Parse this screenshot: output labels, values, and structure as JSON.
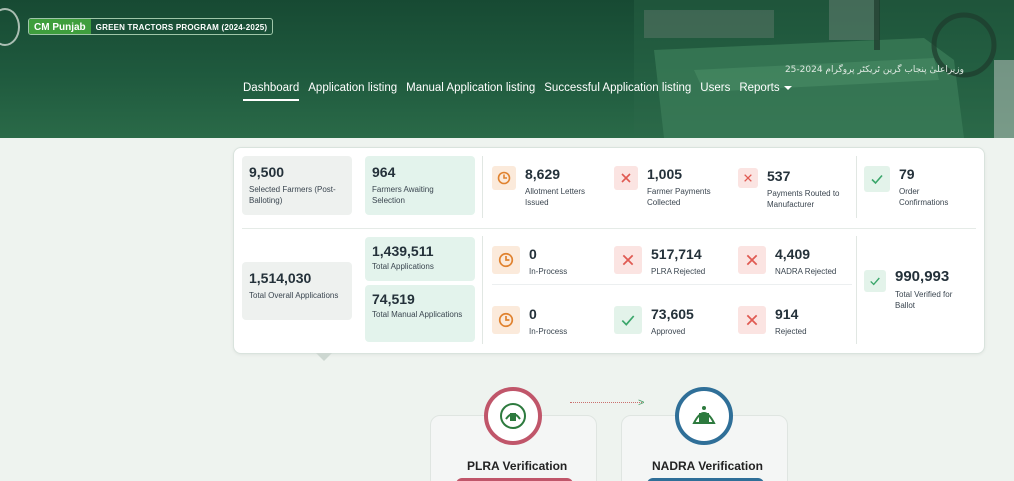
{
  "header": {
    "brand_cm": "CM Punjab",
    "brand_program": "GREEN TRACTORS PROGRAM (2024-2025)",
    "banner_text": "وزیراعلیٰ پنجاب گرین ٹریکٹر پروگرام 2024-25"
  },
  "nav": {
    "dashboard": "Dashboard",
    "application_listing": "Application listing",
    "manual_application_listing": "Manual Application listing",
    "successful_application_listing": "Successful Application listing",
    "users": "Users",
    "reports": "Reports"
  },
  "stats": {
    "selected_farmers": {
      "value": "9,500",
      "label": "Selected Farmers (Post-Balloting)"
    },
    "farmers_awaiting": {
      "value": "964",
      "label": "Farmers Awaiting Selection"
    },
    "allotment_letters": {
      "value": "8,629",
      "label": "Allotment Letters Issued"
    },
    "farmer_payments": {
      "value": "1,005",
      "label": "Farmer Payments Collected"
    },
    "payments_routed": {
      "value": "537",
      "label": "Payments Routed to Manufacturer"
    },
    "order_confirmations": {
      "value": "79",
      "label": "Order Confirmations"
    },
    "total_overall": {
      "value": "1,514,030",
      "label": "Total Overall Applications"
    },
    "total_applications": {
      "value": "1,439,511",
      "label": "Total Applications"
    },
    "total_manual": {
      "value": "74,519",
      "label": "Total Manual Applications"
    },
    "plra_in_process": {
      "value": "0",
      "label": "In-Process"
    },
    "plra_rejected": {
      "value": "517,714",
      "label": "PLRA Rejected"
    },
    "nadra_rejected": {
      "value": "4,409",
      "label": "NADRA Rejected"
    },
    "manual_in_process": {
      "value": "0",
      "label": "In-Process"
    },
    "approved": {
      "value": "73,605",
      "label": "Approved"
    },
    "rejected": {
      "value": "914",
      "label": "Rejected"
    },
    "total_verified": {
      "value": "990,993",
      "label": "Total Verified for Ballot"
    }
  },
  "verification": {
    "plra": {
      "title": "PLRA Verification",
      "color": "#c0566a"
    },
    "nadra": {
      "title": "NADRA Verification",
      "color": "#2f6f98"
    }
  },
  "colors": {
    "header_green": "#1c5239",
    "accent_orange": "#e0822f",
    "accent_red": "#e05a52",
    "accent_green": "#3aa66a"
  }
}
